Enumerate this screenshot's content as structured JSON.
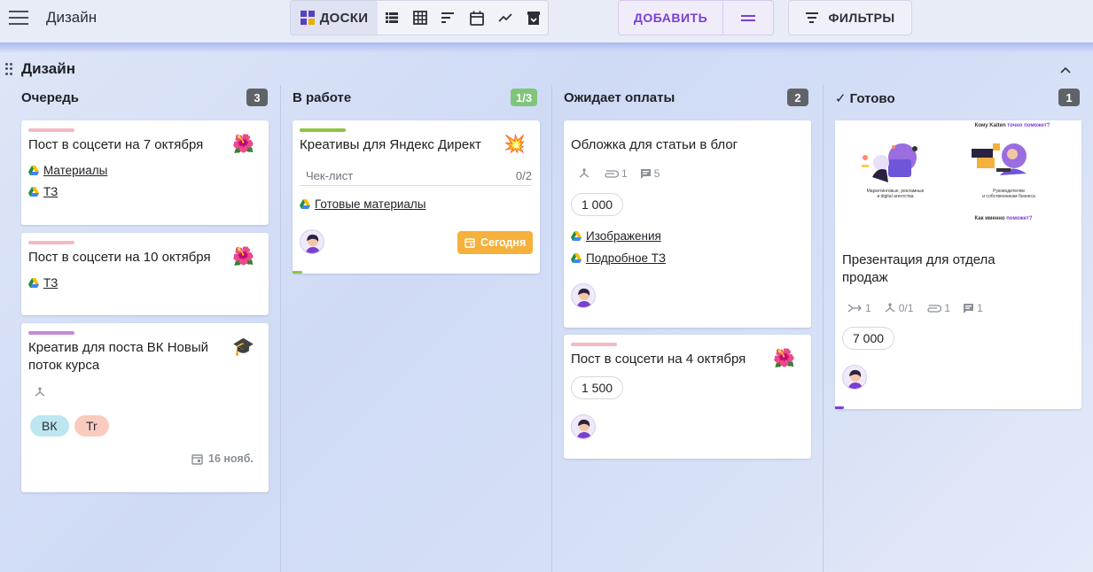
{
  "app": {
    "title": "Дизайн"
  },
  "toolbar": {
    "views": [
      {
        "name": "boards",
        "label": "ДОСКИ",
        "active": true
      },
      {
        "name": "list"
      },
      {
        "name": "table"
      },
      {
        "name": "gantt"
      },
      {
        "name": "calendar"
      },
      {
        "name": "reports"
      },
      {
        "name": "archive"
      }
    ],
    "add_label": "ДОБАВИТЬ",
    "filters_label": "ФИЛЬТРЫ"
  },
  "board": {
    "title": "Дизайн"
  },
  "columns": [
    {
      "title": "Очередь",
      "count": "3",
      "count_color": "#5f6368",
      "cards": [
        {
          "title": "Пост в соцсети на 7 октября",
          "stripe": "#f5b8c2",
          "emoji": "🌺",
          "links": [
            "Материалы",
            "ТЗ"
          ]
        },
        {
          "title": "Пост в соцсети на 10 октября",
          "stripe": "#f5b8c2",
          "emoji": "🌺",
          "links": [
            "ТЗ"
          ]
        },
        {
          "title_line1": "Креатив для поста ВК Новый",
          "title_line2": "поток курса",
          "stripe": "#c58bd9",
          "emoji": "🎓",
          "tags": [
            "ВК",
            "Tr"
          ],
          "date": "16 нояб."
        }
      ]
    },
    {
      "title": "В работе",
      "count": "1/3",
      "count_color": "#7fc57a",
      "cards": [
        {
          "title": "Креативы для Яндекс Директ",
          "stripe": "#8cc63f",
          "emoji": "💥",
          "checklist_label": "Чек-лист",
          "checklist_value": "0/2",
          "links": [
            "Готовые материалы"
          ],
          "due": "Сегодня"
        }
      ]
    },
    {
      "title": "Ожидает оплаты",
      "count": "2",
      "count_color": "#5f6368",
      "cards": [
        {
          "title": "Обложка для статьи в блог",
          "attachments": "1",
          "comments": "5",
          "amount": "1 000",
          "links": [
            "Изображения",
            "Подробное ТЗ"
          ]
        },
        {
          "title": "Пост в соцсети на 4 октября",
          "stripe": "#f5b8c2",
          "emoji": "🌺",
          "amount": "1 500"
        }
      ]
    },
    {
      "title": "Готово",
      "title_prefix": "✓",
      "count": "1",
      "count_color": "#5f6368",
      "cards": [
        {
          "preview": {
            "heading_a": "Кому Kaiten ",
            "heading_b": "точно поможет?",
            "caption_left_1": "Маркетинговые, рекламные",
            "caption_left_2": "и digital агентства",
            "caption_right_1": "Руководителям",
            "caption_right_2": "и собственникам бизнеса",
            "footer_a": "Как именно ",
            "footer_b": "поможет?"
          },
          "title_line1": "Презентация для отдела",
          "title_line2": "продаж",
          "relations": "1",
          "subtasks": "0/1",
          "attachments": "1",
          "comments": "1",
          "amount": "7 000"
        }
      ]
    }
  ],
  "colors": {
    "accent": "#7b3fd0",
    "due": "#f5b13b"
  }
}
